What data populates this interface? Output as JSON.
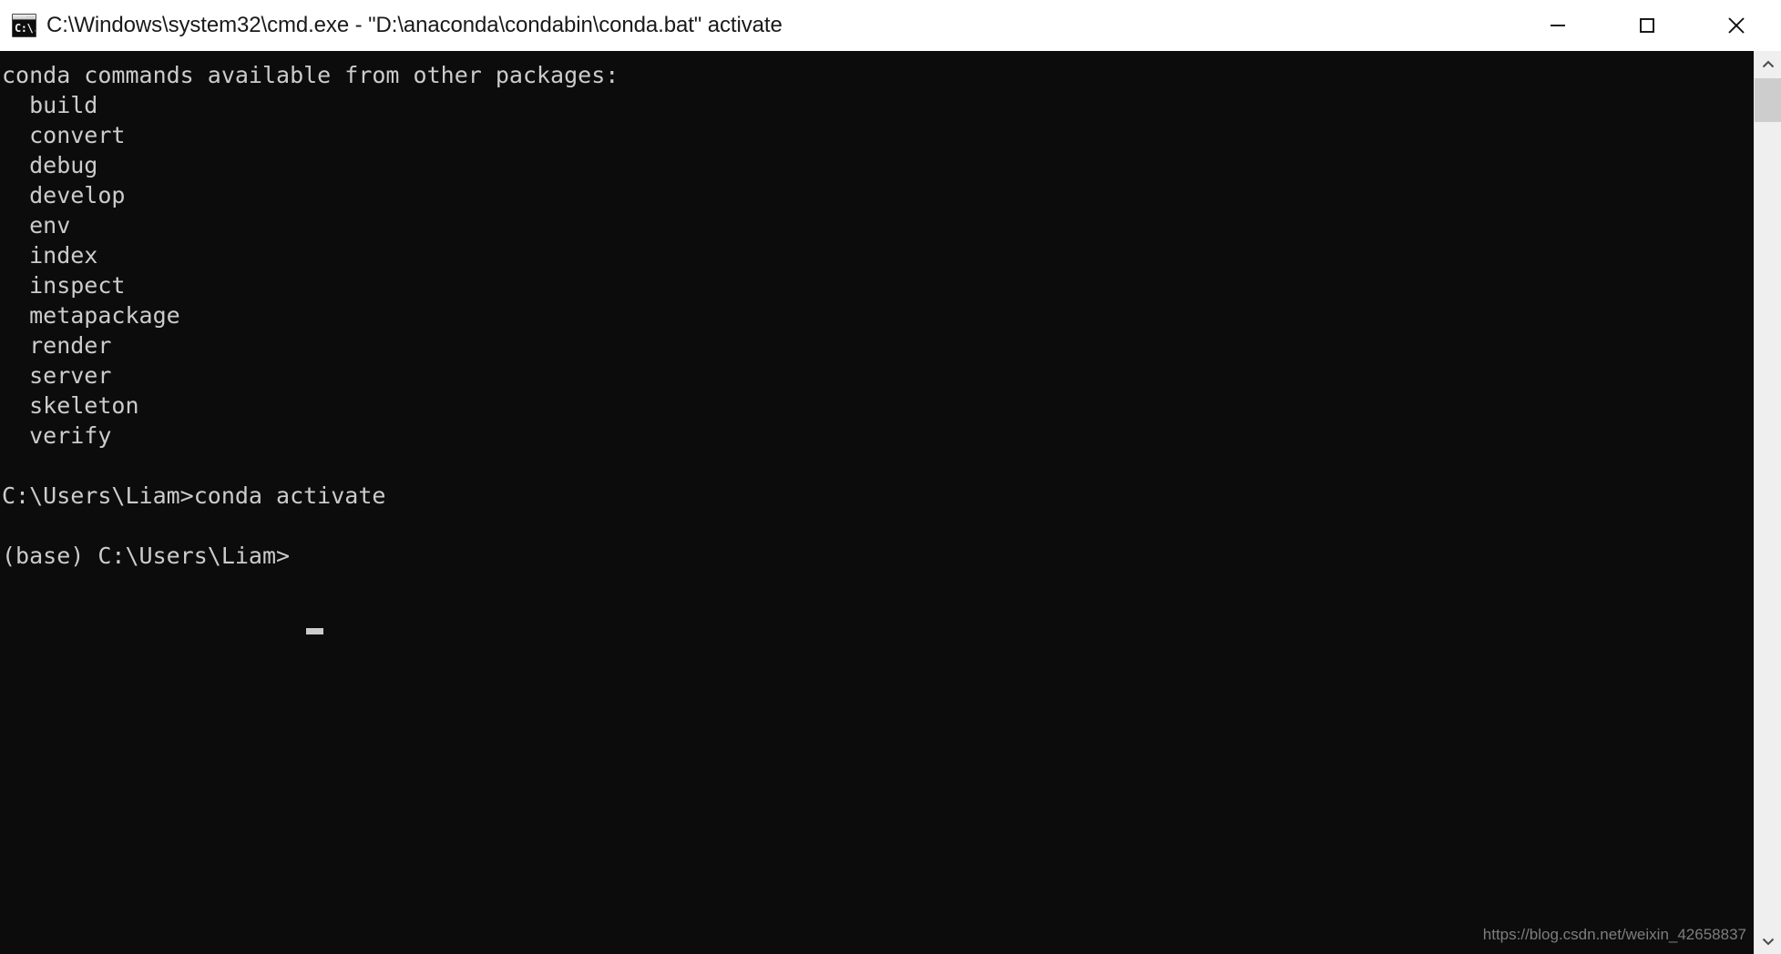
{
  "window": {
    "title": "C:\\Windows\\system32\\cmd.exe - \"D:\\anaconda\\condabin\\conda.bat\"  activate",
    "icon_name": "cmd-exe-icon",
    "icon_glyph": "C:\\.",
    "background": "#0c0c0c",
    "foreground": "#cccccc",
    "titlebar_background": "#ffffff"
  },
  "controls": {
    "minimize_label": "Minimize",
    "maximize_label": "Maximize",
    "close_label": "Close"
  },
  "console": {
    "heading": "conda commands available from other packages:",
    "commands": [
      "build",
      "convert",
      "debug",
      "develop",
      "env",
      "index",
      "inspect",
      "metapackage",
      "render",
      "server",
      "skeleton",
      "verify"
    ],
    "prompt_line": "C:\\Users\\Liam>conda activate",
    "active_prompt": "(base) C:\\Users\\Liam>",
    "cursor": "_",
    "text": "conda commands available from other packages:\n  build\n  convert\n  debug\n  develop\n  env\n  index\n  inspect\n  metapackage\n  render\n  server\n  skeleton\n  verify\n\nC:\\Users\\Liam>conda activate\n\n(base) C:\\Users\\Liam>"
  },
  "watermark": {
    "text": "https://blog.csdn.net/weixin_42658837"
  },
  "scrollbar": {
    "up_arrow": "chevron-up",
    "down_arrow": "chevron-down",
    "thumb_position_pct": 3
  }
}
